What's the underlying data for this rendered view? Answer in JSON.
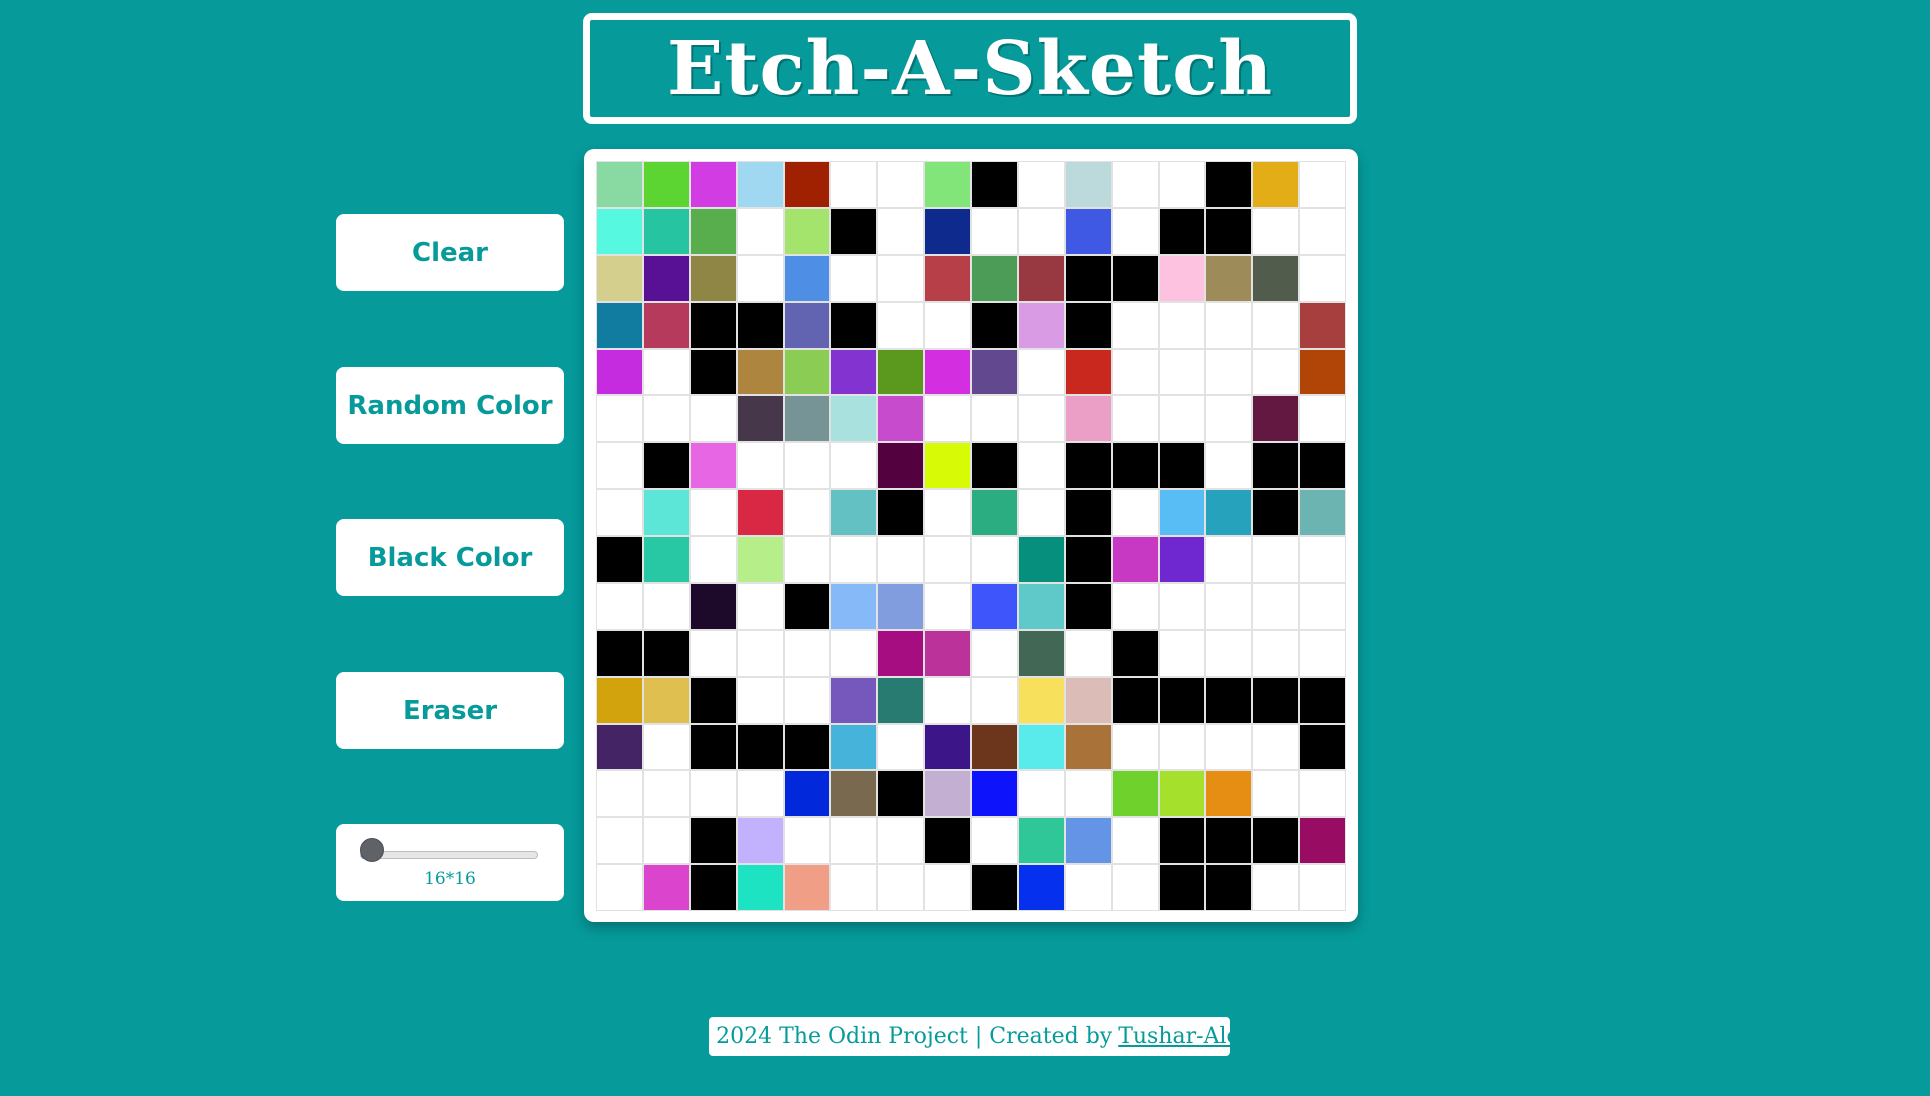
{
  "title": "Etch-A-Sketch",
  "controls": {
    "clear": "Clear",
    "random": "Random Color",
    "black": "Black Color",
    "eraser": "Eraser",
    "grid_size_label": "16*16",
    "grid_size_value": 16,
    "grid_size_min": 16,
    "grid_size_max": 100
  },
  "footer": {
    "text": "© 2024 The Odin Project | Created by",
    "link": "Tushar-Alec"
  },
  "colors": {
    "background": "#069a9a",
    "accent": "#069a9a",
    "slider_fill": "#1a73e8"
  },
  "grid": [
    [
      "#89d9a2",
      "#5cd532",
      "#d13ce3",
      "#9fd8f0",
      "#a02102",
      "#ffffff",
      "#ffffff",
      "#82e57a",
      "#000000",
      "#ffffff",
      "#bcd9dc",
      "#ffffff",
      "#ffffff",
      "#000000",
      "#e2ad17",
      "#ffffff"
    ],
    [
      "#56f9e0",
      "#27c4a1",
      "#58ae4d",
      "#ffffff",
      "#a4e46d",
      "#000000",
      "#ffffff",
      "#0e2a8c",
      "#ffffff",
      "#ffffff",
      "#3f59e4",
      "#ffffff",
      "#000000",
      "#000000",
      "#ffffff",
      "#ffffff"
    ],
    [
      "#d4cf8c",
      "#581094",
      "#8f8646",
      "#ffffff",
      "#4f8ee5",
      "#ffffff",
      "#ffffff",
      "#b63f48",
      "#4c9c57",
      "#983840",
      "#000000",
      "#000000",
      "#fcc2df",
      "#9e8b5a",
      "#525c4d",
      "#ffffff"
    ],
    [
      "#117c9f",
      "#b63a5b",
      "#000000",
      "#000000",
      "#6263b1",
      "#000000",
      "#ffffff",
      "#ffffff",
      "#000000",
      "#d99be3",
      "#000000",
      "#ffffff",
      "#ffffff",
      "#ffffff",
      "#ffffff",
      "#a63f3e"
    ],
    [
      "#c52ce0",
      "#ffffff",
      "#000000",
      "#ae853e",
      "#8bcc55",
      "#8333d0",
      "#5a991d",
      "#d32ee0",
      "#62498f",
      "#ffffff",
      "#c8281d",
      "#ffffff",
      "#ffffff",
      "#ffffff",
      "#ffffff",
      "#b04507"
    ],
    [
      "#ffffff",
      "#ffffff",
      "#ffffff",
      "#47374b",
      "#769495",
      "#a8e1de",
      "#c74bcd",
      "#ffffff",
      "#ffffff",
      "#ffffff",
      "#ec9fc6",
      "#ffffff",
      "#ffffff",
      "#ffffff",
      "#621840",
      "#ffffff"
    ],
    [
      "#ffffff",
      "#000000",
      "#e766e3",
      "#ffffff",
      "#ffffff",
      "#ffffff",
      "#53013f",
      "#d7fb06",
      "#000000",
      "#ffffff",
      "#000000",
      "#000000",
      "#000000",
      "#ffffff",
      "#000000",
      "#000000"
    ],
    [
      "#ffffff",
      "#5be6d8",
      "#ffffff",
      "#d92843",
      "#ffffff",
      "#63c1c4",
      "#000000",
      "#ffffff",
      "#2bac81",
      "#ffffff",
      "#000000",
      "#ffffff",
      "#58bdf4",
      "#27a2bc",
      "#000000",
      "#6bb4b1"
    ],
    [
      "#000000",
      "#29c8a4",
      "#ffffff",
      "#b6ef89",
      "#ffffff",
      "#ffffff",
      "#ffffff",
      "#ffffff",
      "#ffffff",
      "#078f7d",
      "#000000",
      "#c839c3",
      "#6f28cf",
      "#ffffff",
      "#ffffff",
      "#ffffff"
    ],
    [
      "#ffffff",
      "#ffffff",
      "#1d0a2b",
      "#ffffff",
      "#000000",
      "#86b9f7",
      "#829dde",
      "#ffffff",
      "#3f55fc",
      "#5fc8c9",
      "#000000",
      "#ffffff",
      "#ffffff",
      "#ffffff",
      "#ffffff",
      "#ffffff"
    ],
    [
      "#000000",
      "#000000",
      "#ffffff",
      "#ffffff",
      "#ffffff",
      "#ffffff",
      "#a50d81",
      "#bb329b",
      "#ffffff",
      "#426855",
      "#ffffff",
      "#000000",
      "#ffffff",
      "#ffffff",
      "#ffffff",
      "#ffffff"
    ],
    [
      "#d2a30d",
      "#dfbf50",
      "#000000",
      "#ffffff",
      "#ffffff",
      "#7658bd",
      "#277b70",
      "#ffffff",
      "#ffffff",
      "#f7e05c",
      "#dcbcb7",
      "#000000",
      "#000000",
      "#000000",
      "#000000",
      "#000000"
    ],
    [
      "#452465",
      "#ffffff",
      "#000000",
      "#000000",
      "#000000",
      "#45b3da",
      "#ffffff",
      "#3c1689",
      "#6b361c",
      "#59eaeb",
      "#a87238",
      "#ffffff",
      "#ffffff",
      "#ffffff",
      "#ffffff",
      "#000000"
    ],
    [
      "#ffffff",
      "#ffffff",
      "#ffffff",
      "#ffffff",
      "#0128da",
      "#79694f",
      "#000000",
      "#c3afd2",
      "#0d13fa",
      "#ffffff",
      "#ffffff",
      "#6fd22c",
      "#a5e02c",
      "#e68d14",
      "#ffffff",
      "#ffffff"
    ],
    [
      "#ffffff",
      "#ffffff",
      "#000000",
      "#c2b2fe",
      "#ffffff",
      "#ffffff",
      "#ffffff",
      "#000000",
      "#ffffff",
      "#2fc797",
      "#6494e5",
      "#ffffff",
      "#000000",
      "#000000",
      "#000000",
      "#980d63"
    ],
    [
      "#ffffff",
      "#db45ce",
      "#000000",
      "#1ee3c3",
      "#f09f86",
      "#ffffff",
      "#ffffff",
      "#ffffff",
      "#000000",
      "#0530ee",
      "#ffffff",
      "#ffffff",
      "#000000",
      "#000000",
      "#ffffff",
      "#ffffff"
    ]
  ]
}
